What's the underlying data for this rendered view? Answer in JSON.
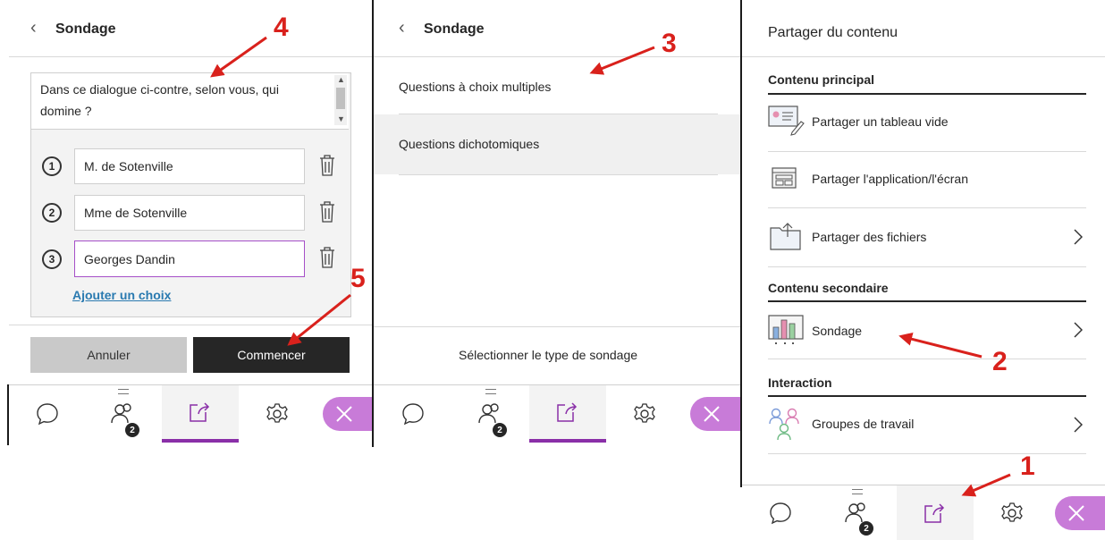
{
  "panel1": {
    "title": "Sondage",
    "question_line1": "Dans ce dialogue ci-contre, selon vous, qui",
    "question_line2": "domine ?",
    "choices": [
      {
        "num": "1",
        "value": "M. de Sotenville"
      },
      {
        "num": "2",
        "value": "Mme de Sotenville"
      },
      {
        "num": "3",
        "value": "Georges Dandin"
      }
    ],
    "add_choice": "Ajouter un choix",
    "cancel": "Annuler",
    "start": "Commencer",
    "participants_badge": "2"
  },
  "panel2": {
    "title": "Sondage",
    "options": [
      "Questions à choix multiples",
      "Questions dichotomiques"
    ],
    "footer_text": "Sélectionner le type de sondage",
    "participants_badge": "2"
  },
  "panel3": {
    "title": "Partager du contenu",
    "section_main": "Contenu principal",
    "share_whiteboard": "Partager un tableau vide",
    "share_app": "Partager l'application/l'écran",
    "share_files": "Partager des fichiers",
    "section_secondary": "Contenu secondaire",
    "poll": "Sondage",
    "section_interaction": "Interaction",
    "groups": "Groupes de travail",
    "participants_badge": "2"
  },
  "annotations": [
    "1",
    "2",
    "3",
    "4",
    "5"
  ],
  "colors": {
    "accent": "#8a2fa8",
    "close": "#c87bd8",
    "annotation": "#d9211c",
    "dark_button": "#262626"
  }
}
